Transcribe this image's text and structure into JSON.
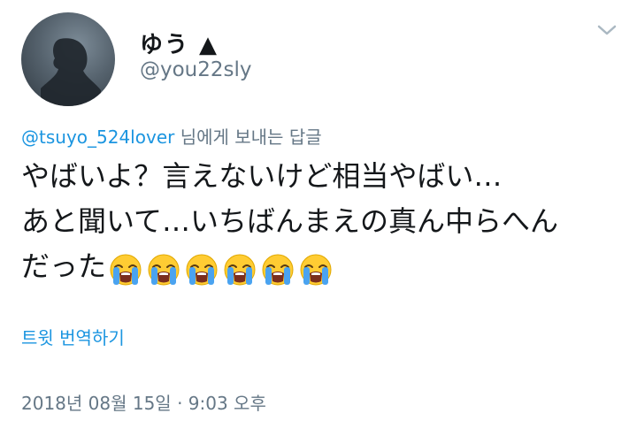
{
  "author": {
    "display_name": "ゆう ▲",
    "username": "@you22sly"
  },
  "reply": {
    "mention": "@tsuyo_524lover",
    "suffix": " 님에게 보내는 답글"
  },
  "tweet": {
    "line1": "やばいよ？言えないけど相当やばい…",
    "line2": "あと聞いて…いちばんまえの真ん中らへん",
    "line3": "だった",
    "emoji_count": 6,
    "emoji_icon": "loudly-crying-face-icon"
  },
  "translate_label": "트윗 번역하기",
  "timestamp": "2018년 08월 15일 · 9:03 오후",
  "icons": {
    "menu": "chevron-down-icon",
    "avatar": "silhouette-avatar"
  },
  "colors": {
    "link": "#1b95e0",
    "secondary": "#657786",
    "text": "#14171a"
  }
}
